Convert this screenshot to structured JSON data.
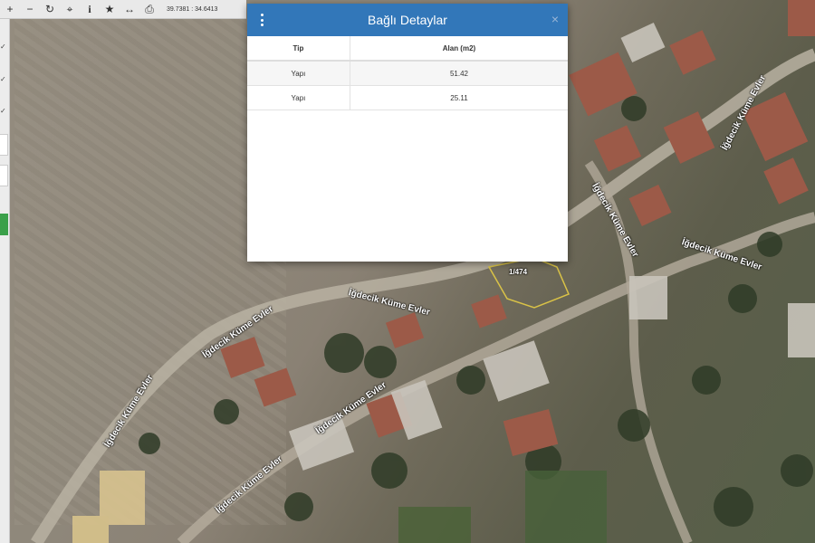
{
  "toolbar": {
    "buttons": [
      {
        "icon": "zoom-in-icon",
        "glyph": "+"
      },
      {
        "icon": "zoom-out-icon",
        "glyph": "−"
      },
      {
        "icon": "refresh-icon",
        "glyph": "↻"
      },
      {
        "icon": "locate-icon",
        "glyph": "⌖"
      },
      {
        "icon": "info-icon",
        "glyph": "i"
      },
      {
        "icon": "favorite-star-icon",
        "glyph": "★"
      },
      {
        "icon": "measure-icon",
        "glyph": "↔"
      },
      {
        "icon": "print-icon",
        "glyph": "⎙"
      }
    ],
    "coordinates": "39.7381 : 34.6413"
  },
  "modal": {
    "title": "Bağlı Detaylar",
    "close": "×",
    "columns": [
      "Tip",
      "Alan (m2)"
    ],
    "rows": [
      {
        "tip": "Yapı",
        "alan": "51.42"
      },
      {
        "tip": "Yapı",
        "alan": "25.11"
      }
    ]
  },
  "map": {
    "parcel_label": "1/474",
    "road_labels": [
      "İğdecik Küme Evler",
      "İğdecik Küme Evler",
      "İğdecik Küme Evler",
      "İğdecik Küme Evler",
      "İğdecik Küme Evler",
      "İğdecik Küme Evler",
      "İğdecik Küme Evler",
      "İğdecik Küme Evler"
    ],
    "parcel_outline_color": "#d9c247",
    "accent_color": "#3277b9"
  }
}
